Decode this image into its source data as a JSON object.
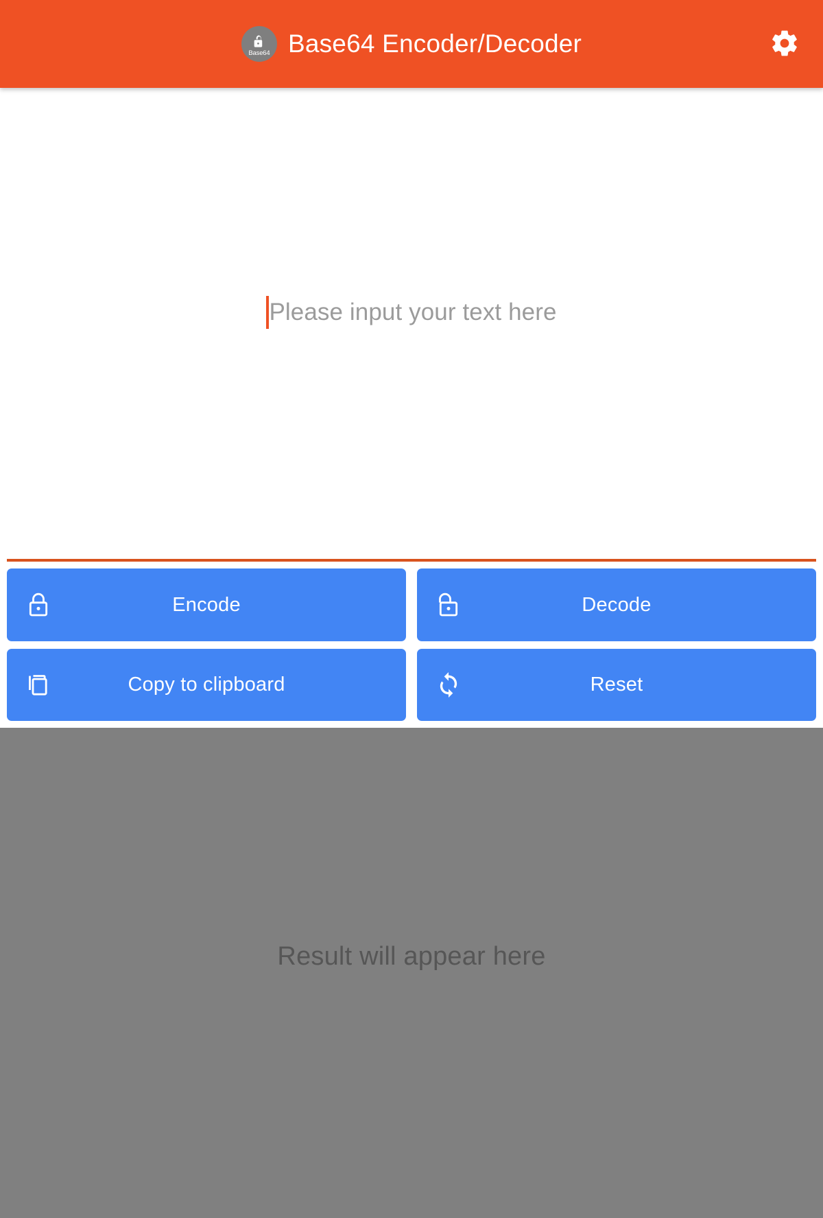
{
  "appbar": {
    "title": "Base64 Encoder/Decoder",
    "icon_name": "app-lock-open-icon",
    "icon_caption": "Base64",
    "settings_icon": "gear-icon",
    "background_color": "#EF5124",
    "text_color": "#FFFFFF",
    "icon_circle_color": "#7F7F7F"
  },
  "input": {
    "placeholder": "Please input your text here",
    "value": "",
    "caret_color": "#EF5124",
    "underline_color": "#D9531E",
    "placeholder_color": "#9B9B9B"
  },
  "buttons": [
    {
      "label": "Encode",
      "icon": "lock-closed-icon",
      "name": "encode-button"
    },
    {
      "label": "Decode",
      "icon": "lock-open-icon",
      "name": "decode-button"
    },
    {
      "label": "Copy to clipboard",
      "icon": "copy-icon",
      "name": "copy-to-clipboard-button"
    },
    {
      "label": "Reset",
      "icon": "refresh-sync-icon",
      "name": "reset-button"
    }
  ],
  "button_style": {
    "background_color": "#4285F4",
    "text_color": "#FFFFFF"
  },
  "result": {
    "placeholder": "Result will appear here",
    "value": "",
    "background_color": "#808080",
    "text_color": "#565656"
  }
}
